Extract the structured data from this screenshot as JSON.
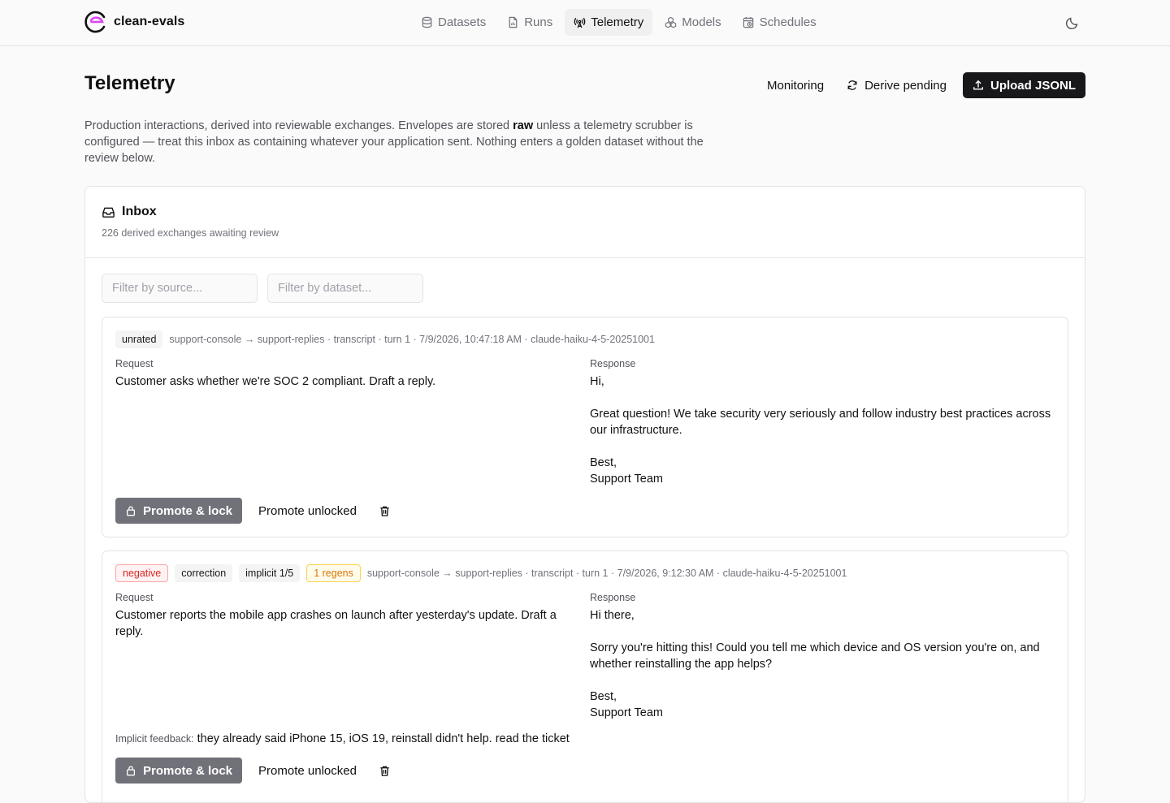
{
  "brand": {
    "name": "clean-evals",
    "accent": "#d946ef"
  },
  "nav": {
    "items": [
      {
        "label": "Datasets",
        "icon": "database-icon"
      },
      {
        "label": "Runs",
        "icon": "document-icon"
      },
      {
        "label": "Telemetry",
        "icon": "antenna-icon",
        "active": true
      },
      {
        "label": "Models",
        "icon": "cubes-icon"
      },
      {
        "label": "Schedules",
        "icon": "calendar-clock-icon"
      }
    ],
    "theme_icon": "moon-icon"
  },
  "header": {
    "title": "Telemetry",
    "monitoring_label": "Monitoring",
    "derive_label": "Derive pending",
    "upload_label": "Upload JSONL"
  },
  "intro": {
    "part1": "Production interactions, derived into reviewable exchanges. Envelopes are stored ",
    "bold": "raw",
    "part2": " unless a telemetry scrubber is configured — treat this inbox as containing whatever your application sent. Nothing enters a golden dataset without the review below."
  },
  "inbox": {
    "title": "Inbox",
    "subtitle": "226 derived exchanges awaiting review",
    "filter_source_placeholder": "Filter by source...",
    "filter_dataset_placeholder": "Filter by dataset..."
  },
  "labels": {
    "request": "Request",
    "response": "Response",
    "promote_lock": "Promote & lock",
    "promote_unlocked": "Promote unlocked",
    "implicit_feedback": "Implicit feedback:"
  },
  "exchanges": [
    {
      "badges": [
        "unrated"
      ],
      "meta": "support-console → support-replies · transcript · turn 1 · 7/9/2026, 10:47:18 AM · claude-haiku-4-5-20251001",
      "request": "Customer asks whether we're SOC 2 compliant. Draft a reply.",
      "response": "Hi,\n\nGreat question! We take security very seriously and follow industry best practices across our infrastructure.\n\nBest,\nSupport Team"
    },
    {
      "badges": [
        "negative",
        "correction",
        "implicit 1/5",
        "1 regens"
      ],
      "meta": "support-console → support-replies · transcript · turn 1 · 7/9/2026, 9:12:30 AM · claude-haiku-4-5-20251001",
      "request": "Customer reports the mobile app crashes on launch after yesterday's update. Draft a reply.",
      "response": "Hi there,\n\nSorry you're hitting this! Could you tell me which device and OS version you're on, and whether reinstalling the app helps?\n\nBest,\nSupport Team",
      "implicit_feedback": "they already said iPhone 15, iOS 19, reinstall didn't help. read the ticket"
    }
  ]
}
